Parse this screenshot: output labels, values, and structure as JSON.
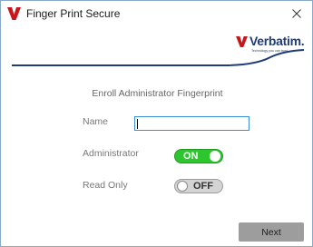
{
  "window": {
    "title": "Finger Print Secure",
    "close_icon": "close-icon"
  },
  "brand": {
    "name": "Verbatim.",
    "tagline": "Technology you can trust",
    "accent": "#c8161d",
    "navy": "#1f3c78"
  },
  "form": {
    "heading": "Enroll Administrator Fingerprint",
    "name_label": "Name",
    "name_value": "",
    "admin_label": "Administrator",
    "admin_toggle": "ON",
    "readonly_label": "Read Only",
    "readonly_toggle": "OFF"
  },
  "actions": {
    "next_label": "Next"
  }
}
